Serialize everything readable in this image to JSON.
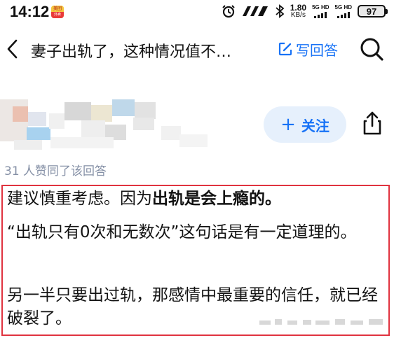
{
  "status_bar": {
    "time": "14:12",
    "app_badge_top": "美团",
    "app_badge_bottom": "外卖",
    "net_speed_value": "1.80",
    "net_speed_unit": "KB/s",
    "sim1_label": "5G HD",
    "sim2_label": "5G HD",
    "battery_level": "97"
  },
  "nav": {
    "title": "妻子出轨了，这种情况值不…",
    "write_answer_label": "写回答"
  },
  "author": {
    "follow_label": "关注"
  },
  "answer": {
    "upvote_text": "31 人赞同了该回答",
    "p1_prefix": "建议慎重考虑。因为",
    "p1_bold": "出轨是会上瘾的。",
    "p2": "“出轨只有0次和无数次”这句话是有一定道理的。",
    "p3": "另一半只要出过轨，那感情中最重要的信任，就已经破裂了。"
  },
  "colors": {
    "accent": "#1772f6",
    "follow_bg": "#e6f0fc",
    "highlight_border": "#e0333f",
    "meta_text": "#8590a6"
  },
  "icons": [
    "back-icon",
    "alarm-icon",
    "bluetooth-icon",
    "edit-icon",
    "search-icon",
    "plus-icon",
    "share-icon"
  ]
}
